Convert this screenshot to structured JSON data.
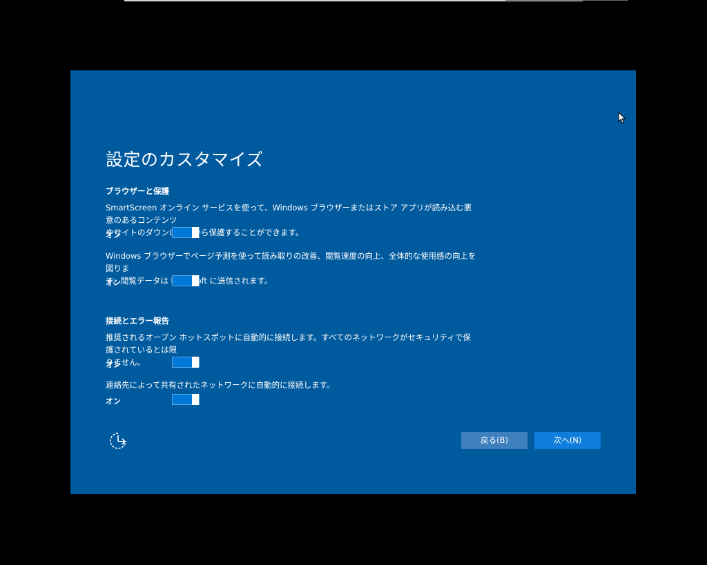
{
  "window": {
    "title": "設定のカスタマイズ"
  },
  "sections": [
    {
      "heading": "ブラウザーと保護",
      "items": [
        {
          "description": "SmartScreen オンライン サービスを使って、Windows ブラウザーまたはストア アプリが読み込む悪意のあるコンテンツ\nやサイトのダウンロードから保護することができます。",
          "toggle_label": "オン",
          "state": true
        },
        {
          "description": "Windows ブラウザーでページ予測を使って読み取りの改善、閲覧速度の向上、全体的な使用感の向上を図りま\nす。閲覧データは Microsoft に送信されます。",
          "toggle_label": "オン",
          "state": true
        }
      ]
    },
    {
      "heading": "接続とエラー報告",
      "items": [
        {
          "description": "推奨されるオープン ホットスポットに自動的に接続します。すべてのネットワークがセキュリティで保護されているとは限\nりません。",
          "toggle_label": "オン",
          "state": true
        },
        {
          "description": "連絡先によって共有されたネットワークに自動的に接続します。",
          "toggle_label": "オン",
          "state": true
        }
      ]
    }
  ],
  "footer": {
    "ease_of_access_icon": "ease-of-access-icon",
    "back_label": "戻る(B)",
    "next_label": "次へ(N)"
  },
  "colors": {
    "background": "#005a9e",
    "toggle_on": "#0078d7",
    "back_button": "#3e80bd",
    "next_button": "#0f7ddb"
  }
}
